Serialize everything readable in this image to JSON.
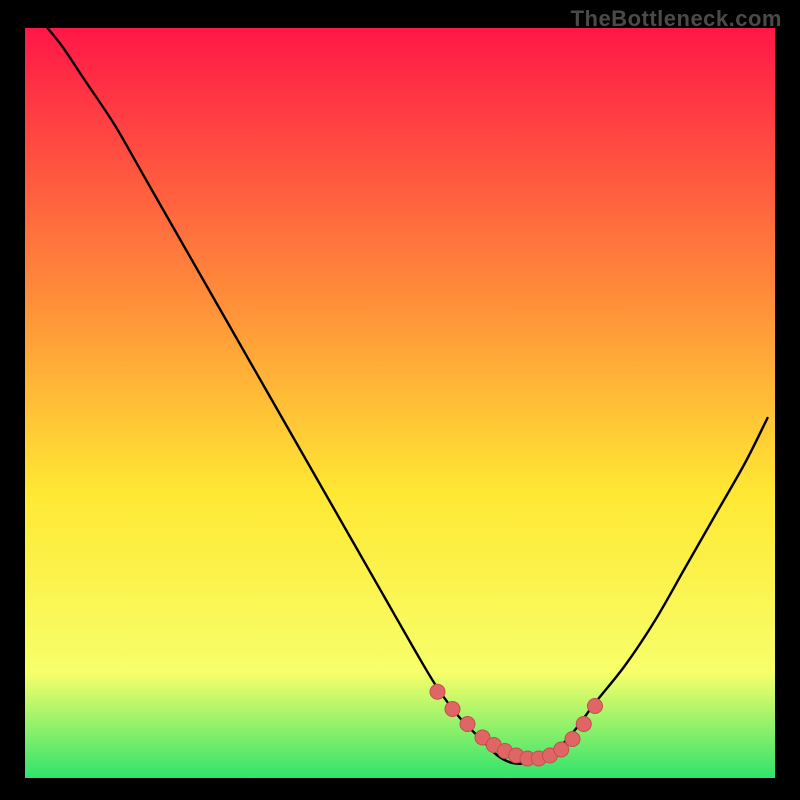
{
  "watermark": "TheBottleneck.com",
  "colors": {
    "gradient_top": "#ff1747",
    "gradient_mid1": "#ff8a3a",
    "gradient_mid2": "#ffe833",
    "gradient_mid3": "#f7ff6a",
    "gradient_bottom": "#2fe36b",
    "curve": "#000000",
    "dots": "#e06666",
    "dots_stroke": "#c24d4d"
  },
  "chart_data": {
    "type": "line",
    "title": "",
    "xlabel": "",
    "ylabel": "",
    "xlim": [
      0,
      100
    ],
    "ylim": [
      0,
      100
    ],
    "series": [
      {
        "name": "bottleneck-curve",
        "x": [
          3,
          5,
          8,
          12,
          16,
          20,
          24,
          28,
          32,
          36,
          40,
          44,
          48,
          52,
          55,
          58,
          61,
          63,
          65,
          67,
          70,
          73,
          76,
          80,
          84,
          88,
          92,
          96,
          99
        ],
        "values": [
          100,
          97.5,
          93,
          87,
          80,
          73,
          66,
          59,
          52,
          45,
          38,
          31,
          24,
          17,
          12,
          8,
          5,
          3,
          2,
          2,
          3,
          6,
          10,
          15,
          21,
          28,
          35,
          42,
          48
        ]
      }
    ],
    "marker_points": {
      "name": "highlighted-range",
      "x": [
        55,
        57,
        59,
        61,
        62.5,
        64,
        65.5,
        67,
        68.5,
        70,
        71.5,
        73,
        74.5,
        76
      ],
      "values": [
        11.5,
        9.2,
        7.2,
        5.4,
        4.4,
        3.6,
        3.0,
        2.6,
        2.6,
        3.0,
        3.8,
        5.2,
        7.2,
        9.6
      ]
    }
  }
}
